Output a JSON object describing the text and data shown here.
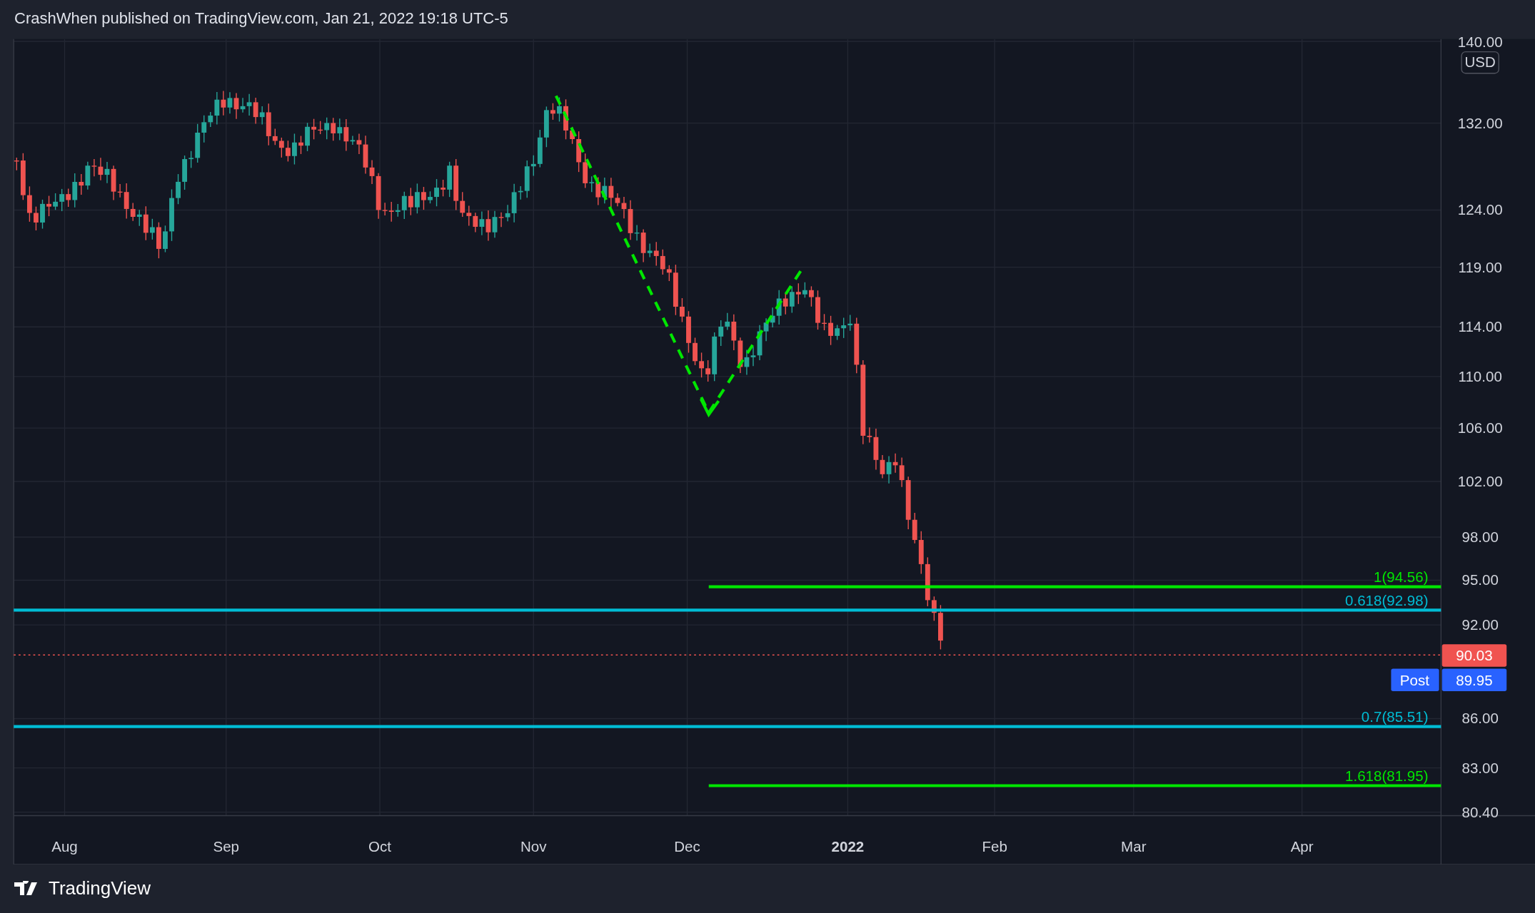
{
  "header": {
    "title": "CrashWhen published on TradingView.com, Jan 21, 2022 19:18 UTC-5"
  },
  "chart": {
    "currency": "USD",
    "price_axis": [
      {
        "label": "140.00"
      },
      {
        "label": "132.00"
      },
      {
        "label": "124.00"
      },
      {
        "label": "119.00"
      },
      {
        "label": "114.00"
      },
      {
        "label": "110.00"
      },
      {
        "label": "106.00"
      },
      {
        "label": "102.00"
      },
      {
        "label": "98.00"
      },
      {
        "label": "95.00"
      },
      {
        "label": "92.00"
      },
      {
        "label": "86.00"
      },
      {
        "label": "83.00"
      },
      {
        "label": "80.40"
      }
    ],
    "time_axis": [
      {
        "label": "Aug",
        "kind": "month"
      },
      {
        "label": "Sep",
        "kind": "month"
      },
      {
        "label": "Oct",
        "kind": "month"
      },
      {
        "label": "Nov",
        "kind": "month"
      },
      {
        "label": "Dec",
        "kind": "month"
      },
      {
        "label": "2022",
        "kind": "year"
      },
      {
        "label": "Feb",
        "kind": "month"
      },
      {
        "label": "Mar",
        "kind": "month"
      },
      {
        "label": "Apr",
        "kind": "month"
      }
    ],
    "levels": [
      {
        "label": "1(94.56)",
        "color": "#00e600",
        "kind": "partial"
      },
      {
        "label": "0.618(92.98)",
        "color": "#00bcd4",
        "kind": "full"
      },
      {
        "label": "0.7(85.51)",
        "color": "#00bcd4",
        "kind": "full"
      },
      {
        "label": "1.618(81.95)",
        "color": "#00e600",
        "kind": "partial"
      }
    ],
    "last_price": "90.03",
    "post": {
      "tag": "Post",
      "price": "89.95"
    }
  },
  "footer": {
    "brand": "TradingView"
  }
}
